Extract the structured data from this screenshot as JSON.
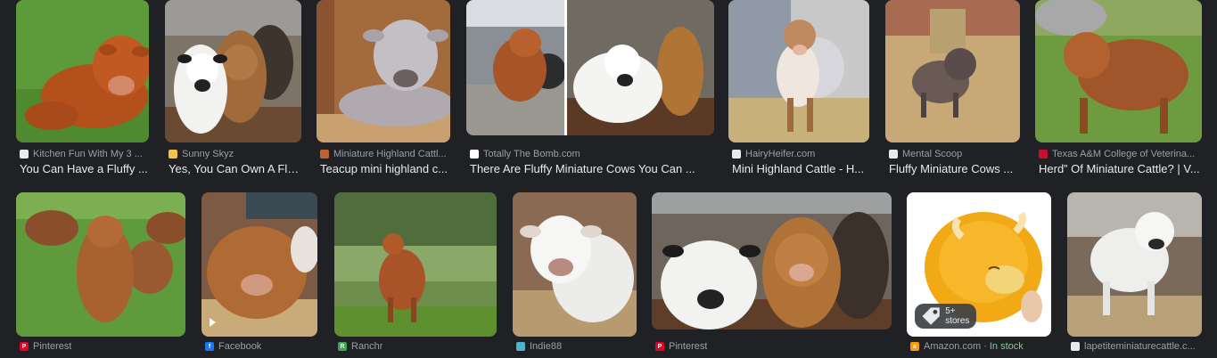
{
  "results": [
    {
      "source": "Kitchen Fun With My 3 ...",
      "title": "You Can Have a Fluffy ...",
      "favicon_color": "#e8eaed"
    },
    {
      "source": "Sunny Skyz",
      "title": "Yes, You Can Own A Flu...",
      "favicon_color": "#f6c445"
    },
    {
      "source": "Miniature Highland Cattl...",
      "title": "Teacup mini highland c...",
      "favicon_color": "#c0622b"
    },
    {
      "source": "Totally The Bomb.com",
      "title": "There Are Fluffy Miniature Cows You Can ...",
      "favicon_color": "#ffffff"
    },
    {
      "source": "HairyHeifer.com",
      "title": "Mini Highland Cattle - H...",
      "favicon_color": "#e8eaed"
    },
    {
      "source": "Mental Scoop",
      "title": "Fluffy Miniature Cows ...",
      "favicon_color": "#e8eaed"
    },
    {
      "source": "Texas A&M College of Veterina...",
      "title": "Herd” Of Miniature Cattle? | V...",
      "favicon_color": "#c8102e"
    },
    {
      "source": "Pinterest",
      "title": "",
      "favicon_color": "#e60023"
    },
    {
      "source": "Facebook",
      "title": "",
      "favicon_color": "#1877f2"
    },
    {
      "source": "Ranchr",
      "title": "",
      "favicon_color": "#34a853"
    },
    {
      "source": "Indie88",
      "title": "",
      "favicon_color": "#4fb3c9"
    },
    {
      "source": "Pinterest",
      "title": "",
      "favicon_color": "#e60023"
    },
    {
      "source": "Amazon.com",
      "stock": "In stock",
      "title": "",
      "favicon_color": "#ff9900",
      "badge": "5+ stores"
    },
    {
      "source": "lapetiteminiaturecattle.c...",
      "title": "",
      "favicon_color": "#e8eaed"
    }
  ],
  "icons": {
    "shopping": "shopping-tag-icon",
    "video": "play-icon"
  }
}
